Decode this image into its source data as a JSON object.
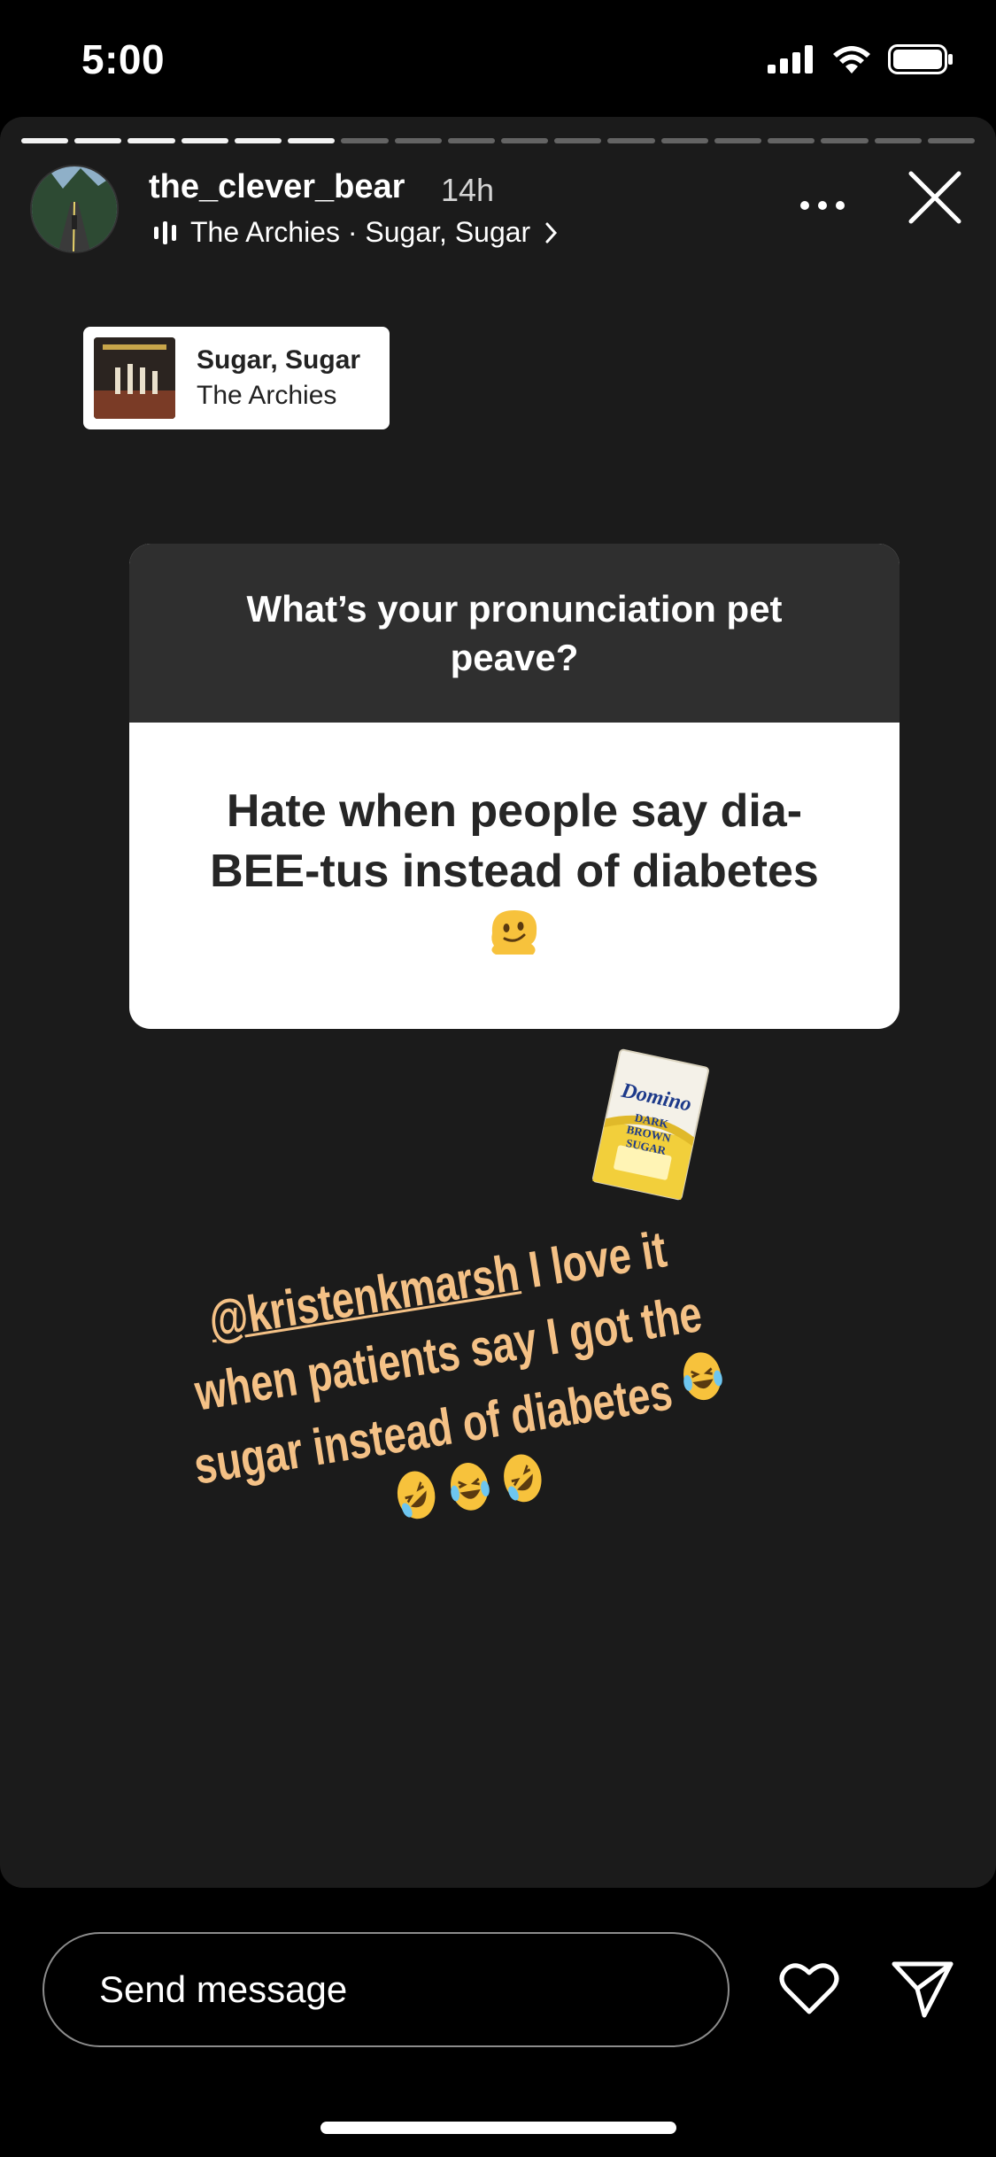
{
  "status": {
    "time": "5:00"
  },
  "story": {
    "username": "the_clever_bear",
    "time_ago": "14h",
    "music_line": "The Archies · Sugar, Sugar",
    "segments_total": 18,
    "segments_done": 6
  },
  "music_sticker": {
    "title": "Sugar, Sugar",
    "artist": "The Archies"
  },
  "question": {
    "prompt": "What’s your pronunciation pet peave?",
    "answer": "Hate when people say dia-BEE-tus instead of diabetes"
  },
  "caption": {
    "mention": "@kristenkmarsh",
    "text": " I love it when patients say I got the sugar instead of diabetes",
    "emojis": "😂🤣😂🤣"
  },
  "sugar_box": {
    "brand": "Domino",
    "label": "DARK BROWN SUGAR"
  },
  "message_bar": {
    "placeholder": "Send message"
  },
  "colors": {
    "caption": "#f4c186",
    "story_bg": "#1b1b1b",
    "card_header": "#2f2f2f"
  }
}
